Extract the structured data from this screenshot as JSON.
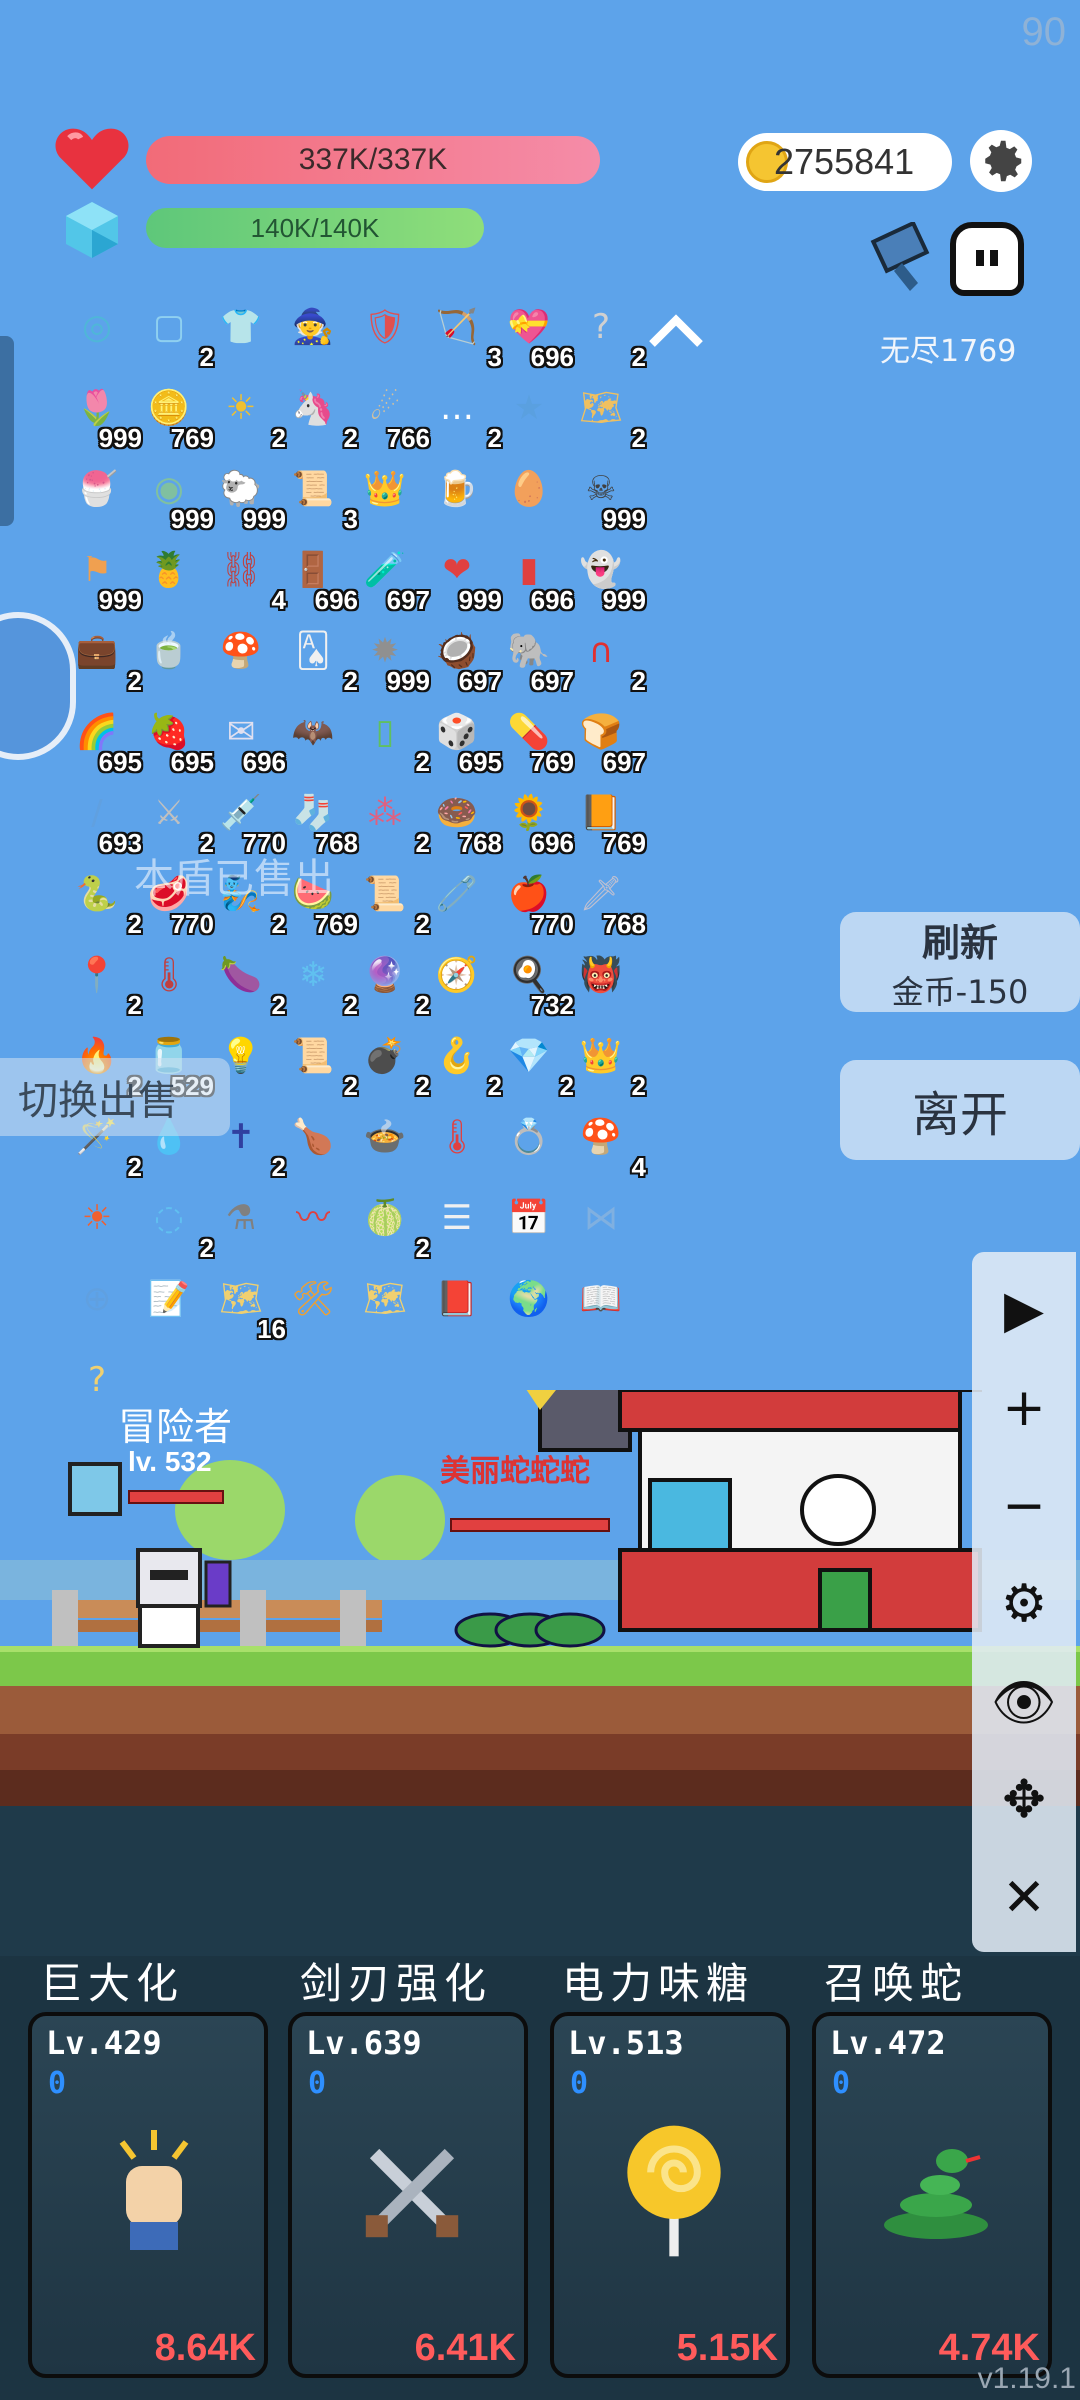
{
  "fps": "90",
  "hp": "337K/337K",
  "mp": "140K/140K",
  "coins": "2755841",
  "endless": "无尽1769",
  "inventory_rows": [
    [
      {
        "icon": "◎",
        "count": "",
        "color": "#4fb6d8"
      },
      {
        "icon": "▢",
        "count": "2",
        "color": "#8fd0f0"
      },
      {
        "icon": "👕",
        "count": "",
        "color": "#bcd8f0"
      },
      {
        "icon": "🧙",
        "count": "",
        "color": "#7a6ad0"
      },
      {
        "icon": "🛡",
        "count": "",
        "color": "#e05050"
      },
      {
        "icon": "🏹",
        "count": "3",
        "color": "#c89a40"
      },
      {
        "icon": "💝",
        "count": "696",
        "color": "#6ab46a"
      },
      {
        "icon": "?",
        "count": "2",
        "color": "#d0d0d0"
      }
    ],
    [
      {
        "icon": "🌷",
        "count": "999",
        "color": "#b080d0"
      },
      {
        "icon": "🪙",
        "count": "769",
        "color": "#e8b030"
      },
      {
        "icon": "☀",
        "count": "2",
        "color": "#f0c030"
      },
      {
        "icon": "🦄",
        "count": "2",
        "color": "#c0c0e0"
      },
      {
        "icon": "☄",
        "count": "766",
        "color": "#d0c0a0"
      },
      {
        "icon": "…",
        "count": "2",
        "color": "#ffffff"
      },
      {
        "icon": "★",
        "count": "",
        "color": "#5aa0e0"
      },
      {
        "icon": "🗺",
        "count": "2",
        "color": "#f0c060"
      }
    ],
    [
      {
        "icon": "🍧",
        "count": "",
        "color": "#f09090"
      },
      {
        "icon": "◉",
        "count": "999",
        "color": "#80c0a0"
      },
      {
        "icon": "🐑",
        "count": "999",
        "color": "#a0c8f0"
      },
      {
        "icon": "📜",
        "count": "3",
        "color": "#f0c060"
      },
      {
        "icon": "👑",
        "count": "",
        "color": "#f0c030"
      },
      {
        "icon": "🍺",
        "count": "",
        "color": "#f0c040"
      },
      {
        "icon": "🥚",
        "count": "",
        "color": "#d0c030"
      },
      {
        "icon": "☠",
        "count": "999",
        "color": "#404040"
      }
    ],
    [
      {
        "icon": "⚑",
        "count": "999",
        "color": "#f0a050"
      },
      {
        "icon": "🍍",
        "count": "",
        "color": "#f0c030"
      },
      {
        "icon": "⛓",
        "count": "4",
        "color": "#c04040"
      },
      {
        "icon": "🚪",
        "count": "696",
        "color": "#a06040"
      },
      {
        "icon": "🧪",
        "count": "697",
        "color": "#e06080"
      },
      {
        "icon": "❤",
        "count": "999",
        "color": "#e04040"
      },
      {
        "icon": "▮",
        "count": "696",
        "color": "#e04040"
      },
      {
        "icon": "👻",
        "count": "999",
        "color": "#f0f0f0"
      }
    ],
    [
      {
        "icon": "💼",
        "count": "2",
        "color": "#e09040"
      },
      {
        "icon": "🍵",
        "count": "",
        "color": "#60c060"
      },
      {
        "icon": "🍄",
        "count": "",
        "color": "#8a5a3a"
      },
      {
        "icon": "🂡",
        "count": "2",
        "color": "#f0f0f0"
      },
      {
        "icon": "✹",
        "count": "999",
        "color": "#909090"
      },
      {
        "icon": "🥥",
        "count": "697",
        "color": "#806040"
      },
      {
        "icon": "🐘",
        "count": "697",
        "color": "#9090a0"
      },
      {
        "icon": "∩",
        "count": "2",
        "color": "#e03030"
      }
    ],
    [
      {
        "icon": "🌈",
        "count": "695",
        "color": "#e0a050"
      },
      {
        "icon": "🍓",
        "count": "695",
        "color": "#e04040"
      },
      {
        "icon": "✉",
        "count": "696",
        "color": "#e0e0f0"
      },
      {
        "icon": "🦇",
        "count": "",
        "color": "#5da3ea"
      },
      {
        "icon": "▯",
        "count": "2",
        "color": "#60c060"
      },
      {
        "icon": "🎲",
        "count": "695",
        "color": "#f0f0f0"
      },
      {
        "icon": "💊",
        "count": "769",
        "color": "#a0b0f0"
      },
      {
        "icon": "🍞",
        "count": "697",
        "color": "#e0a040"
      }
    ],
    [
      {
        "icon": "/",
        "count": "693",
        "color": "#60a0e0"
      },
      {
        "icon": "⚔",
        "count": "2",
        "color": "#c0c0c0"
      },
      {
        "icon": "💉",
        "count": "770",
        "color": "#e04040"
      },
      {
        "icon": "🧦",
        "count": "768",
        "color": "#e04040"
      },
      {
        "icon": "⁂",
        "count": "2",
        "color": "#e06080"
      },
      {
        "icon": "🍩",
        "count": "768",
        "color": "#a06040"
      },
      {
        "icon": "🌻",
        "count": "696",
        "color": "#f0c030"
      },
      {
        "icon": "📙",
        "count": "769",
        "color": "#e0a040"
      }
    ],
    [
      {
        "icon": "🐍",
        "count": "2",
        "color": "#40a040"
      },
      {
        "icon": "🥩",
        "count": "770",
        "color": "#e06060"
      },
      {
        "icon": "🧞",
        "count": "2",
        "color": "#60c080"
      },
      {
        "icon": "🍉",
        "count": "769",
        "color": "#e04040"
      },
      {
        "icon": "📜",
        "count": "2",
        "color": "#f0c060"
      },
      {
        "icon": "🧷",
        "count": "",
        "color": "#c0c0c0"
      },
      {
        "icon": "🍎",
        "count": "770",
        "color": "#e03030"
      },
      {
        "icon": "🗡",
        "count": "768",
        "color": "#c0c0d0"
      }
    ],
    [
      {
        "icon": "📍",
        "count": "2",
        "color": "#e04040"
      },
      {
        "icon": "🌡",
        "count": "",
        "color": "#c04040"
      },
      {
        "icon": "🍆",
        "count": "2",
        "color": "#9040c0"
      },
      {
        "icon": "❄",
        "count": "2",
        "color": "#60c0f0"
      },
      {
        "icon": "🔮",
        "count": "2",
        "color": "#9050d0"
      },
      {
        "icon": "🧭",
        "count": "",
        "color": "#c0c0c0"
      },
      {
        "icon": "🍳",
        "count": "732",
        "color": "#f0f0f0"
      },
      {
        "icon": "👹",
        "count": "",
        "color": "#e04020"
      }
    ],
    [
      {
        "icon": "🔥",
        "count": "2",
        "color": "#f06030"
      },
      {
        "icon": "🫙",
        "count": "529",
        "color": "#e04040"
      },
      {
        "icon": "💡",
        "count": "",
        "color": "#f0f0c0"
      },
      {
        "icon": "📜",
        "count": "2",
        "color": "#60b0e0"
      },
      {
        "icon": "💣",
        "count": "2",
        "color": "#404040"
      },
      {
        "icon": "🪝",
        "count": "2",
        "color": "#e05050"
      },
      {
        "icon": "💎",
        "count": "2",
        "color": "#e03040"
      },
      {
        "icon": "👑",
        "count": "2",
        "color": "#f09030"
      }
    ],
    [
      {
        "icon": "🪄",
        "count": "2",
        "color": "#f0c030"
      },
      {
        "icon": "💧",
        "count": "",
        "color": "#e03060"
      },
      {
        "icon": "✝",
        "count": "2",
        "color": "#3040a0"
      },
      {
        "icon": "🍗",
        "count": "",
        "color": "#a06040"
      },
      {
        "icon": "🍲",
        "count": "",
        "color": "#303030"
      },
      {
        "icon": "🌡",
        "count": "",
        "color": "#e04040"
      },
      {
        "icon": "💍",
        "count": "",
        "color": "#f0c030"
      },
      {
        "icon": "🍄",
        "count": "4",
        "color": "#e04040"
      }
    ],
    [
      {
        "icon": "☀",
        "count": "",
        "color": "#f06030"
      },
      {
        "icon": "◌",
        "count": "2",
        "color": "#60c0f0"
      },
      {
        "icon": "⚗",
        "count": "",
        "color": "#808080"
      },
      {
        "icon": "〰",
        "count": "",
        "color": "#e04040"
      },
      {
        "icon": "🍈",
        "count": "2",
        "color": "#80c040"
      },
      {
        "icon": "☰",
        "count": "",
        "color": "#f0f0f0"
      },
      {
        "icon": "📅",
        "count": "",
        "color": "#f0f0f0"
      },
      {
        "icon": "⋈",
        "count": "",
        "color": "#80b0e0"
      }
    ],
    [
      {
        "icon": "⊕",
        "count": "",
        "color": "#60a0e0"
      },
      {
        "icon": "📝",
        "count": "",
        "color": "#f0d070"
      },
      {
        "icon": "🗺",
        "count": "16",
        "color": "#f0d070"
      },
      {
        "icon": "🛠",
        "count": "",
        "color": "#f0a030"
      },
      {
        "icon": "🗺",
        "count": "",
        "color": "#f0d070"
      },
      {
        "icon": "📕",
        "count": "",
        "color": "#404050"
      },
      {
        "icon": "🌍",
        "count": "",
        "color": "#f0d070"
      },
      {
        "icon": "📖",
        "count": "",
        "color": "#f0f0f0"
      }
    ],
    [
      {
        "icon": "?",
        "count": "",
        "color": "#f0d070"
      }
    ]
  ],
  "sold_text": "本盾已售出",
  "switch_text": "切换出售",
  "refresh": {
    "label": "刷新",
    "cost": "金币-150"
  },
  "leave_label": "离开",
  "adventurer": {
    "name": "冒险者",
    "level": "lv. 532"
  },
  "enemy_name": "美丽蛇蛇蛇",
  "skills": [
    {
      "name": "巨大化",
      "level": "Lv.429",
      "points": "0",
      "cost": "8.64K",
      "icon": "fist-icon"
    },
    {
      "name": "剑刃强化",
      "level": "Lv.639",
      "points": "0",
      "cost": "6.41K",
      "icon": "crossed-swords-icon"
    },
    {
      "name": "电力味糖",
      "level": "Lv.513",
      "points": "0",
      "cost": "5.15K",
      "icon": "lollipop-icon"
    },
    {
      "name": "召唤蛇",
      "level": "Lv.472",
      "points": "0",
      "cost": "4.74K",
      "icon": "snake-icon"
    }
  ],
  "version": "v1.19.1"
}
